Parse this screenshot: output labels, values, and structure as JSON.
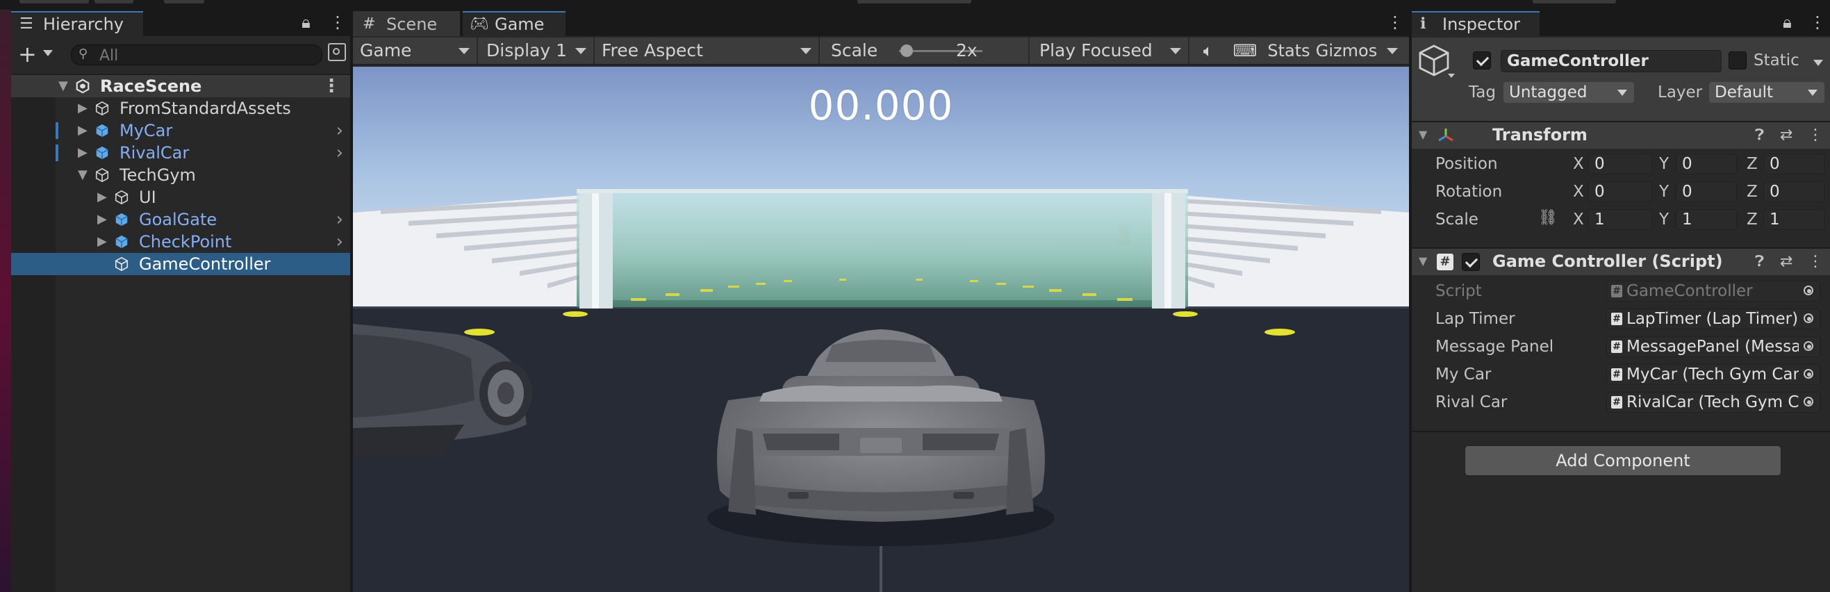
{
  "hierarchy": {
    "tab_label": "Hierarchy",
    "search_placeholder": "All",
    "items": [
      {
        "label": "RaceScene",
        "kind": "scene"
      },
      {
        "label": "FromStandardAssets",
        "kind": "object"
      },
      {
        "label": "MyCar",
        "kind": "prefab"
      },
      {
        "label": "RivalCar",
        "kind": "prefab"
      },
      {
        "label": "TechGym",
        "kind": "object"
      },
      {
        "label": "UI",
        "kind": "object"
      },
      {
        "label": "GoalGate",
        "kind": "prefab"
      },
      {
        "label": "CheckPoint",
        "kind": "prefab"
      },
      {
        "label": "GameController",
        "kind": "object",
        "selected": true
      }
    ]
  },
  "center": {
    "tabs": [
      {
        "label": "Scene",
        "icon": "hash-grid-icon"
      },
      {
        "label": "Game",
        "icon": "gamepad-icon",
        "active": true
      }
    ],
    "toolbar": {
      "mode": "Game",
      "display": "Display 1",
      "aspect": "Free Aspect",
      "scale_label": "Scale",
      "scale_value": "2x",
      "play_mode": "Play Focused",
      "stats": "Stats",
      "gizmos": "Gizmos"
    },
    "timer": "00.000"
  },
  "inspector": {
    "tab_label": "Inspector",
    "object": {
      "name": "GameController",
      "active": true,
      "static_label": "Static",
      "tag_label": "Tag",
      "tag_value": "Untagged",
      "layer_label": "Layer",
      "layer_value": "Default"
    },
    "transform": {
      "title": "Transform",
      "rows": [
        {
          "label": "Position",
          "x": "0",
          "y": "0",
          "z": "0"
        },
        {
          "label": "Rotation",
          "x": "0",
          "y": "0",
          "z": "0"
        },
        {
          "label": "Scale",
          "x": "1",
          "y": "1",
          "z": "1"
        }
      ]
    },
    "script_component": {
      "title": "Game Controller (Script)",
      "enabled": true,
      "fields": [
        {
          "label": "Script",
          "value": "GameController",
          "disabled": true
        },
        {
          "label": "Lap Timer",
          "value": "LapTimer (Lap Timer)"
        },
        {
          "label": "Message Panel",
          "value": "MessagePanel (Messa"
        },
        {
          "label": "My Car",
          "value": "MyCar (Tech Gym Car"
        },
        {
          "label": "Rival Car",
          "value": "RivalCar (Tech Gym Ca"
        }
      ]
    },
    "add_component": "Add Component"
  },
  "colors": {
    "selection": "#2c5d87",
    "prefab_text": "#85aef2",
    "sky_top": "#7f98c8",
    "ground": "#262b36"
  }
}
